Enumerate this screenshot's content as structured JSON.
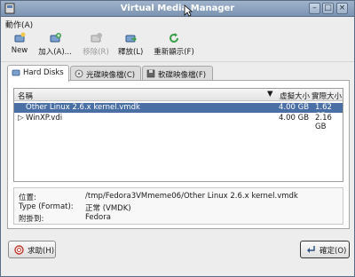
{
  "window": {
    "title": "Virtual Media Manager",
    "app_icon": "virtualbox-icon"
  },
  "menubar": {
    "items": [
      {
        "label": "動作(A)"
      }
    ]
  },
  "toolbar": {
    "new": {
      "label": "New",
      "icon": "new-disk-icon",
      "enabled": true
    },
    "add": {
      "label": "加入(A)...",
      "icon": "add-disk-icon",
      "enabled": true
    },
    "remove": {
      "label": "移除(R)",
      "icon": "remove-disk-icon",
      "enabled": false
    },
    "release": {
      "label": "釋放(L)",
      "icon": "release-disk-icon",
      "enabled": true
    },
    "refresh": {
      "label": "重新顯示(F)",
      "icon": "refresh-icon",
      "enabled": true
    }
  },
  "tabs": [
    {
      "label": "Hard Disks",
      "icon": "hard-disk-icon",
      "active": true
    },
    {
      "label": "光碟映像檔(C)",
      "icon": "optical-disc-icon",
      "active": false
    },
    {
      "label": "軟碟映像檔(F)",
      "icon": "floppy-icon",
      "active": false
    }
  ],
  "list": {
    "columns": {
      "name": "名稱",
      "virtual_size": "虛擬大小",
      "actual_size": "實際大小"
    },
    "rows": [
      {
        "name": "Other Linux 2.6.x kernel.vmdk",
        "virtual_size": "4.00 GB",
        "actual_size": "1.62 GB",
        "selected": true,
        "expander": ""
      },
      {
        "name": "WinXP.vdi",
        "virtual_size": "4.00 GB",
        "actual_size": "2.16 GB",
        "selected": false,
        "expander": "▷"
      }
    ]
  },
  "info": [
    {
      "label": "位置:",
      "value": "/tmp/Fedora3VMmeme06/Other  Linux  2.6.x  kernel.vmdk"
    },
    {
      "label": "Type  (Format):",
      "value": "正常  (VMDK)"
    },
    {
      "label": "附掛到:",
      "value": "Fedora"
    }
  ],
  "buttons": {
    "help": "求助(H)",
    "ok": "確定(O)"
  },
  "colors": {
    "titlebar": "#7b93b2",
    "selection": "#4a6fa5",
    "accent_green": "#3aa04a"
  }
}
